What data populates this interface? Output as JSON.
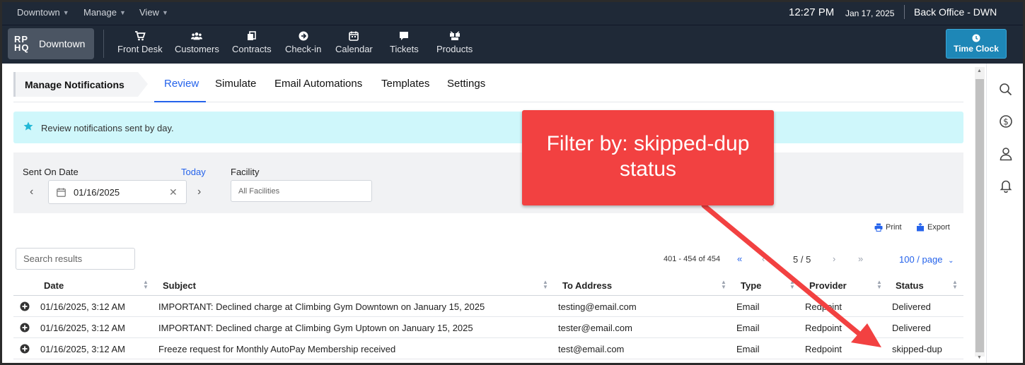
{
  "topbar": {
    "menus": [
      "Downtown",
      "Manage",
      "View"
    ],
    "time": "12:27 PM",
    "date": "Jan 17, 2025",
    "location": "Back Office - DWN"
  },
  "logo": {
    "mark": "RP HQ",
    "mark_top": "RP",
    "mark_bottom": "HQ",
    "location": "Downtown"
  },
  "nav": {
    "items": [
      {
        "label": "Front Desk",
        "icon": "cart-icon"
      },
      {
        "label": "Customers",
        "icon": "users-icon"
      },
      {
        "label": "Contracts",
        "icon": "documents-icon"
      },
      {
        "label": "Check-in",
        "icon": "arrow-circle-icon"
      },
      {
        "label": "Calendar",
        "icon": "calendar-icon"
      },
      {
        "label": "Tickets",
        "icon": "chat-icon"
      },
      {
        "label": "Products",
        "icon": "boxes-icon"
      }
    ],
    "time_clock": "Time Clock"
  },
  "page": {
    "title": "Manage Notifications",
    "tabs": [
      "Review",
      "Simulate",
      "Email Automations",
      "Templates",
      "Settings"
    ],
    "active_tab": "Review",
    "banner": "Review notifications sent by day."
  },
  "filters": {
    "sent_on_label": "Sent On Date",
    "today_label": "Today",
    "date_value": "01/16/2025",
    "facility_label": "Facility",
    "facility_placeholder": "All Facilities"
  },
  "actions": {
    "print": "Print",
    "export": "Export"
  },
  "search": {
    "placeholder": "Search results"
  },
  "pagination": {
    "range": "401 - 454 of 454",
    "page_current": "5",
    "page_total": "5",
    "page_text": "5 / 5",
    "per_page": "100 / page"
  },
  "table": {
    "columns": [
      "Date",
      "Subject",
      "To Address",
      "Type",
      "Provider",
      "Status"
    ],
    "rows": [
      {
        "date": "01/16/2025, 3:12 AM",
        "subject": "IMPORTANT: Declined charge at Climbing Gym Downtown on January 15, 2025",
        "to": "testing@email.com",
        "type": "Email",
        "provider": "Redpoint",
        "status": "Delivered"
      },
      {
        "date": "01/16/2025, 3:12 AM",
        "subject": "IMPORTANT: Declined charge at Climbing Gym Uptown on January 15, 2025",
        "to": "tester@email.com",
        "type": "Email",
        "provider": "Redpoint",
        "status": "Delivered"
      },
      {
        "date": "01/16/2025, 3:12 AM",
        "subject": "Freeze request for Monthly AutoPay Membership received",
        "to": "test@email.com",
        "type": "Email",
        "provider": "Redpoint",
        "status": "skipped-dup"
      }
    ]
  },
  "annotation": {
    "text": "Filter by: skipped-dup status",
    "color": "#f24141"
  },
  "colors": {
    "nav_bg": "#1f2937",
    "accent": "#2563eb",
    "time_clock": "#1e87b7",
    "banner": "#cff7fb"
  }
}
